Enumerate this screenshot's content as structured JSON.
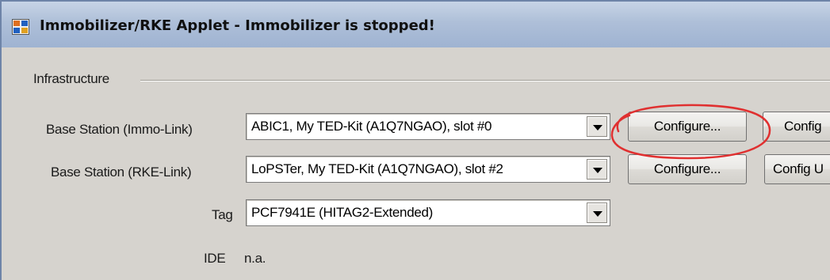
{
  "window": {
    "title": "Immobilizer/RKE Applet - Immobilizer is stopped!"
  },
  "group": {
    "label": "Infrastructure"
  },
  "rows": {
    "immo": {
      "label": "Base Station (Immo-Link)",
      "value": "ABIC1, My TED-Kit (A1Q7NGAO), slot #0",
      "configure_label": "Configure...",
      "config_label": "Config"
    },
    "rke": {
      "label": "Base Station (RKE-Link)",
      "value": "LoPSTer, My TED-Kit (A1Q7NGAO), slot #2",
      "configure_label": "Configure...",
      "config_label": "Config U"
    },
    "tag": {
      "label": "Tag",
      "value": "PCF7941E (HITAG2-Extended)"
    },
    "ide": {
      "label": "IDE",
      "value": "n.a."
    }
  },
  "icons": {
    "app": "applet-window-icon",
    "dropdown": "chevron-down-icon",
    "annotation": "red-ellipse-annotation"
  },
  "colors": {
    "annotation": "#e03030",
    "titlebar": "#aebfd8"
  }
}
